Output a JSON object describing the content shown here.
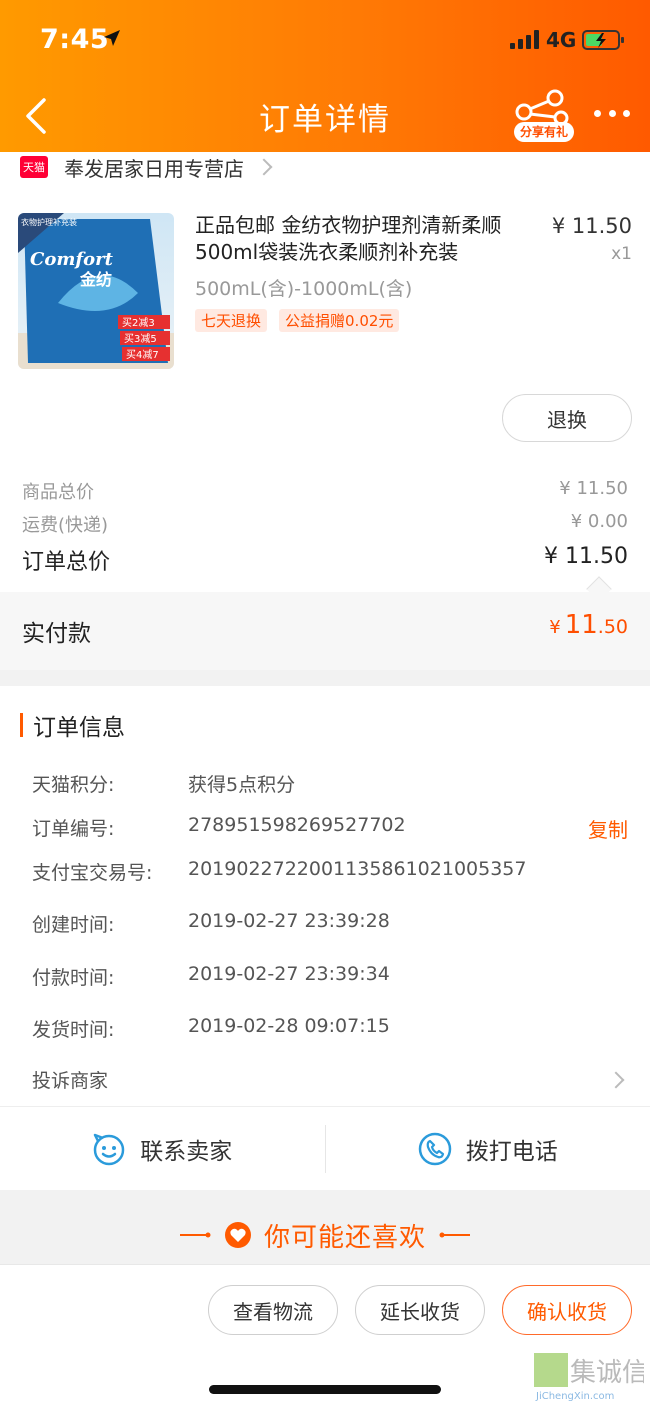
{
  "status_bar": {
    "time": "7:45",
    "network": "4G"
  },
  "nav": {
    "title": "订单详情",
    "share_label": "分享有礼"
  },
  "store": {
    "badge": "天猫",
    "name": "奉发居家日用专营店"
  },
  "product": {
    "title": "正品包邮 金纺衣物护理剂清新柔顺500ml袋装洗衣柔顺剂补充装",
    "price": "¥ 11.50",
    "qty": "x1",
    "sku": "500mL(含)-1000mL(含)",
    "tags": [
      "七天退换",
      "公益捐赠0.02元"
    ],
    "thumb_text": {
      "corner": "衣物护理补充装",
      "brand": "Comfort",
      "brand_cn": "金纺",
      "promos": [
        "买2减3",
        "买3减5",
        "买4减7"
      ]
    },
    "refund_label": "退换"
  },
  "summary": {
    "goods_total_label": "商品总价",
    "goods_total": "¥ 11.50",
    "shipping_label": "运费(快递)",
    "shipping": "¥ 0.00",
    "order_total_label": "订单总价",
    "order_total": "¥ 11.50"
  },
  "paid": {
    "label": "实付款",
    "currency": "¥",
    "int": "11",
    "dec": ".50"
  },
  "order_info": {
    "title": "订单信息",
    "rows": [
      {
        "key": "天猫积分:",
        "value": "获得5点积分"
      },
      {
        "key": "订单编号:",
        "value": "278951598269527702"
      },
      {
        "key": "支付宝交易号:",
        "value": "2019022722001135861021005357"
      },
      {
        "key": "创建时间:",
        "value": "2019-02-27 23:39:28"
      },
      {
        "key": "付款时间:",
        "value": "2019-02-27 23:39:34"
      },
      {
        "key": "发货时间:",
        "value": "2019-02-28 09:07:15"
      }
    ],
    "copy_label": "复制",
    "complain_label": "投诉商家"
  },
  "contact": {
    "seller_label": "联系卖家",
    "phone_label": "拨打电话"
  },
  "recommend": {
    "label": "你可能还喜欢"
  },
  "bottom_buttons": {
    "logistics": "查看物流",
    "extend": "延长收货",
    "confirm": "确认收货"
  },
  "watermark": {
    "cn": "集诚信",
    "en": "JiChengXin.com"
  },
  "colors": {
    "accent": "#ff5a00",
    "header_start": "#ff9a00",
    "header_end": "#ff5a00",
    "tmall_red": "#ff0036"
  }
}
